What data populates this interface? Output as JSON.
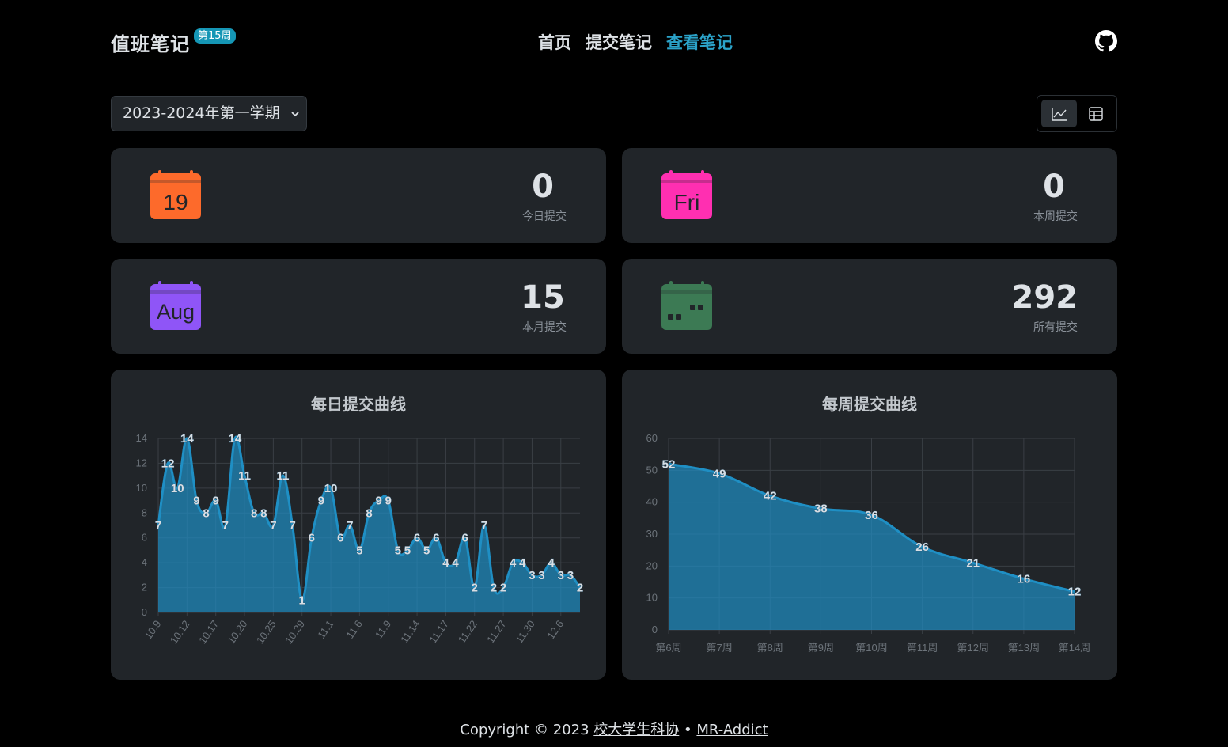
{
  "header": {
    "title": "值班笔记",
    "week_badge": "第15周",
    "nav": [
      "首页",
      "提交笔记",
      "查看笔记"
    ],
    "active_nav": 2,
    "github_icon": "github-icon"
  },
  "controls": {
    "semester": "2023-2024年第一学期",
    "view_modes": [
      "chart-icon",
      "table-icon"
    ],
    "active_view": 0
  },
  "stats": [
    {
      "icon_text": "19",
      "icon_color": "#fd6a2b",
      "value": "0",
      "label": "今日提交"
    },
    {
      "icon_text": "Fri",
      "icon_color": "#ff2fb1",
      "value": "0",
      "label": "本周提交"
    },
    {
      "icon_text": "Aug",
      "icon_color": "#8f55f7",
      "value": "15",
      "label": "本月提交"
    },
    {
      "icon_text": "",
      "icon_color": "#3c7a54",
      "value": "292",
      "label": "所有提交"
    }
  ],
  "charts": {
    "daily_title": "每日提交曲线",
    "weekly_title": "每周提交曲线"
  },
  "chart_data": [
    {
      "type": "area",
      "title": "每日提交曲线",
      "x_ticks": [
        "10.9",
        "10.12",
        "10.17",
        "10.20",
        "10.25",
        "10.29",
        "11.1",
        "11.6",
        "11.9",
        "11.14",
        "11.17",
        "11.22",
        "11.27",
        "11.30",
        "12.6"
      ],
      "values": [
        7,
        12,
        10,
        14,
        9,
        8,
        9,
        7,
        14,
        11,
        8,
        8,
        7,
        11,
        7,
        1,
        6,
        9,
        10,
        6,
        7,
        5,
        8,
        9,
        9,
        5,
        5,
        6,
        5,
        6,
        4,
        4,
        6,
        2,
        7,
        2,
        2,
        4,
        4,
        3,
        3,
        4,
        3,
        3,
        2
      ],
      "ylim": [
        0,
        14
      ],
      "y_ticks": [
        0,
        2,
        4,
        6,
        8,
        10,
        12,
        14
      ],
      "color": "#1f8fc4",
      "grid": true
    },
    {
      "type": "area",
      "title": "每周提交曲线",
      "categories": [
        "第6周",
        "第7周",
        "第8周",
        "第9周",
        "第10周",
        "第11周",
        "第12周",
        "第13周",
        "第14周"
      ],
      "values": [
        52,
        49,
        42,
        38,
        36,
        26,
        21,
        16,
        12
      ],
      "ylim": [
        0,
        60
      ],
      "y_ticks": [
        0,
        10,
        20,
        30,
        40,
        50,
        60
      ],
      "color": "#1f8fc4",
      "grid": true
    }
  ],
  "footer": {
    "copyright": "Copyright © 2023",
    "org_link": "校大学生科协",
    "separator": "•",
    "author_link": "MR-Addict"
  }
}
